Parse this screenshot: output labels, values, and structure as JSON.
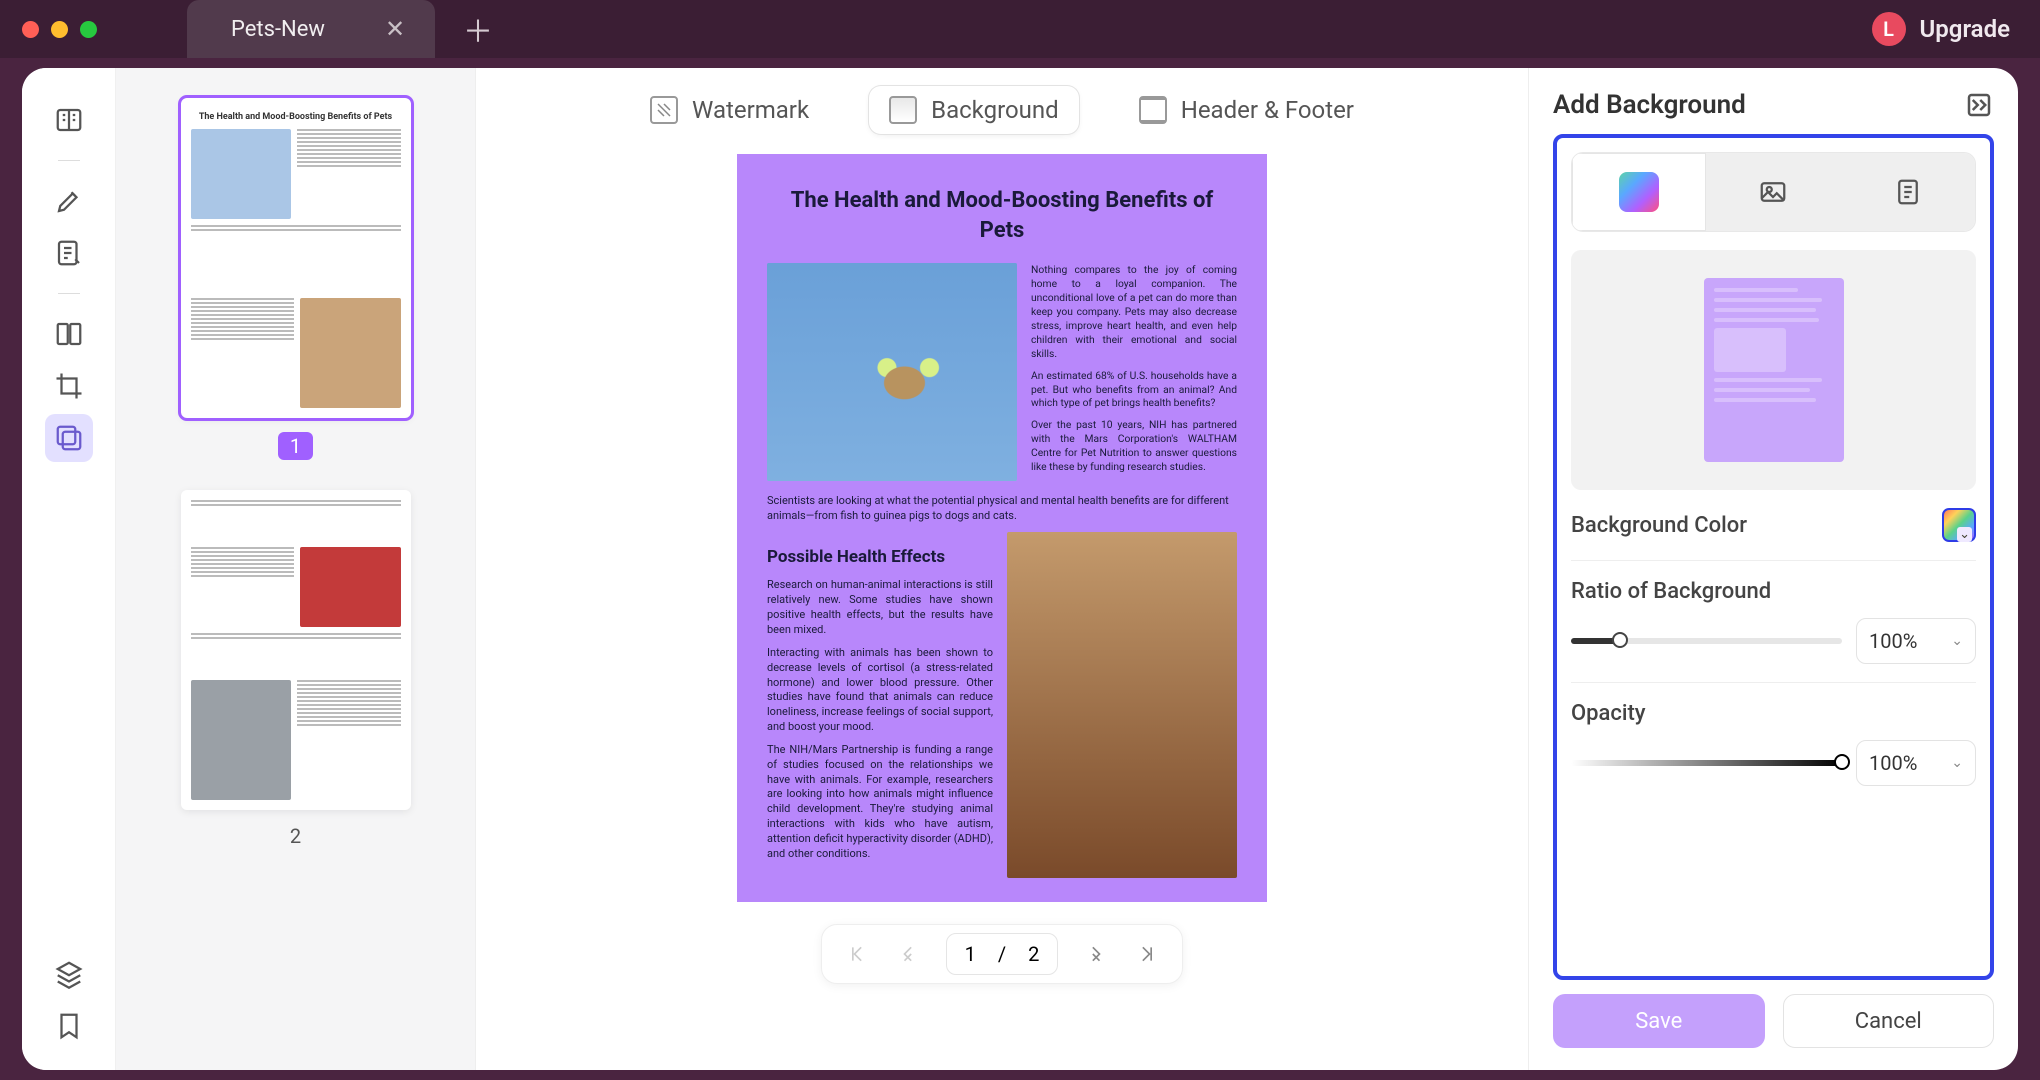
{
  "window": {
    "tab_title": "Pets-New",
    "upgrade_label": "Upgrade",
    "avatar_initial": "L"
  },
  "thumbs": {
    "page1_num": "1",
    "page2_num": "2",
    "page1_title": "The Health and Mood-Boosting Benefits of Pets"
  },
  "toptabs": {
    "watermark": "Watermark",
    "background": "Background",
    "header_footer": "Header & Footer"
  },
  "document": {
    "title": "The Health and Mood-Boosting Benefits of Pets",
    "intro1": "Nothing compares to the joy of coming home to a loyal companion. The unconditional love of a pet can do more than keep you company. Pets may also decrease stress, improve heart health, and even help children with their emotional and social skills.",
    "intro2": "An estimated 68% of U.S. households have a pet. But who benefits from an animal? And which type of pet brings health benefits?",
    "intro3": "Over the past 10 years, NIH has partnered with the Mars Corporation's WALTHAM Centre for Pet Nutrition to answer questions like these by funding research studies.",
    "midline": "Scientists are looking at what the potential physical and mental health benefits are for different animals—from fish to guinea pigs to dogs and cats.",
    "h2": "Possible Health Effects",
    "body1": "Research on human-animal interactions is still relatively new. Some studies have shown positive health effects, but the results have been mixed.",
    "body2": "Interacting with animals has been shown to decrease levels of cortisol (a stress-related hormone) and lower blood pressure. Other studies have found that animals can reduce loneliness, increase feelings of social support, and boost your mood.",
    "body3": "The NIH/Mars Partnership is funding a range of studies focused on the relationships we have with animals. For example, researchers are looking into how animals might influence child development. They're studying animal interactions with kids who have autism, attention deficit hyperactivity disorder (ADHD), and other conditions."
  },
  "pager": {
    "current": "1",
    "sep": "/",
    "total": "2"
  },
  "panel": {
    "title": "Add Background",
    "bg_color_label": "Background Color",
    "ratio_label": "Ratio of Background",
    "ratio_value": "100%",
    "opacity_label": "Opacity",
    "opacity_value": "100%",
    "save": "Save",
    "cancel": "Cancel"
  }
}
